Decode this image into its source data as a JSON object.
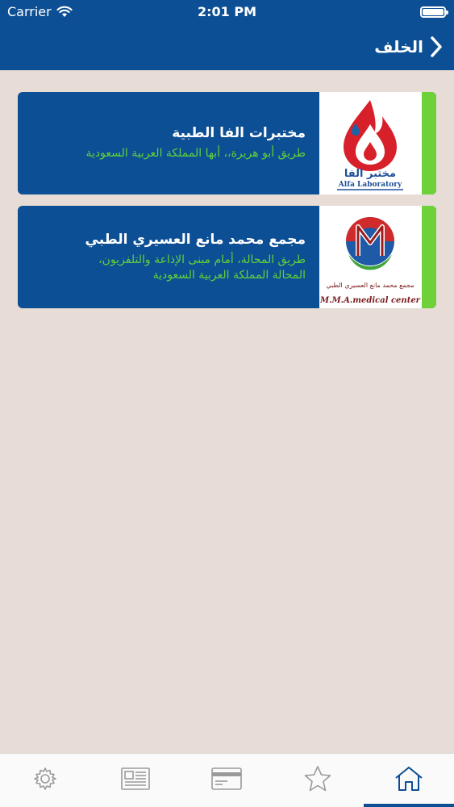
{
  "status": {
    "carrier": "Carrier",
    "time": "2:01 PM"
  },
  "nav": {
    "back_label": "الخلف"
  },
  "places": [
    {
      "name": "مختبرات الفا الطبية",
      "address_lines": [
        "طريق أبو هريرة،، أبها المملكة العربية السعودية"
      ],
      "logo": {
        "text_arabic": "مختبر الفا",
        "text_latin": "Alfa Laboratory"
      }
    },
    {
      "name": "مجمع محمد مانع العسيري الطبي",
      "address_lines": [
        "طريق المحالة، أمام مبنى الإذاعة والتلفزيون،",
        "المحالة المملكة العربية السعودية"
      ],
      "logo": {
        "text_arabic": "مجمع محمد مانع العسيري الطبي",
        "text_latin": "M.M.A.medical center"
      }
    }
  ],
  "tabbar": {
    "items": [
      {
        "icon": "gear-icon"
      },
      {
        "icon": "newspaper-icon"
      },
      {
        "icon": "card-icon"
      },
      {
        "icon": "star-icon"
      },
      {
        "icon": "home-icon",
        "active": true
      }
    ]
  },
  "colors": {
    "brand": "#0d4f94",
    "accent_green": "#6ed13a",
    "address_green": "#5fd23b",
    "background": "#e7dcd6"
  }
}
